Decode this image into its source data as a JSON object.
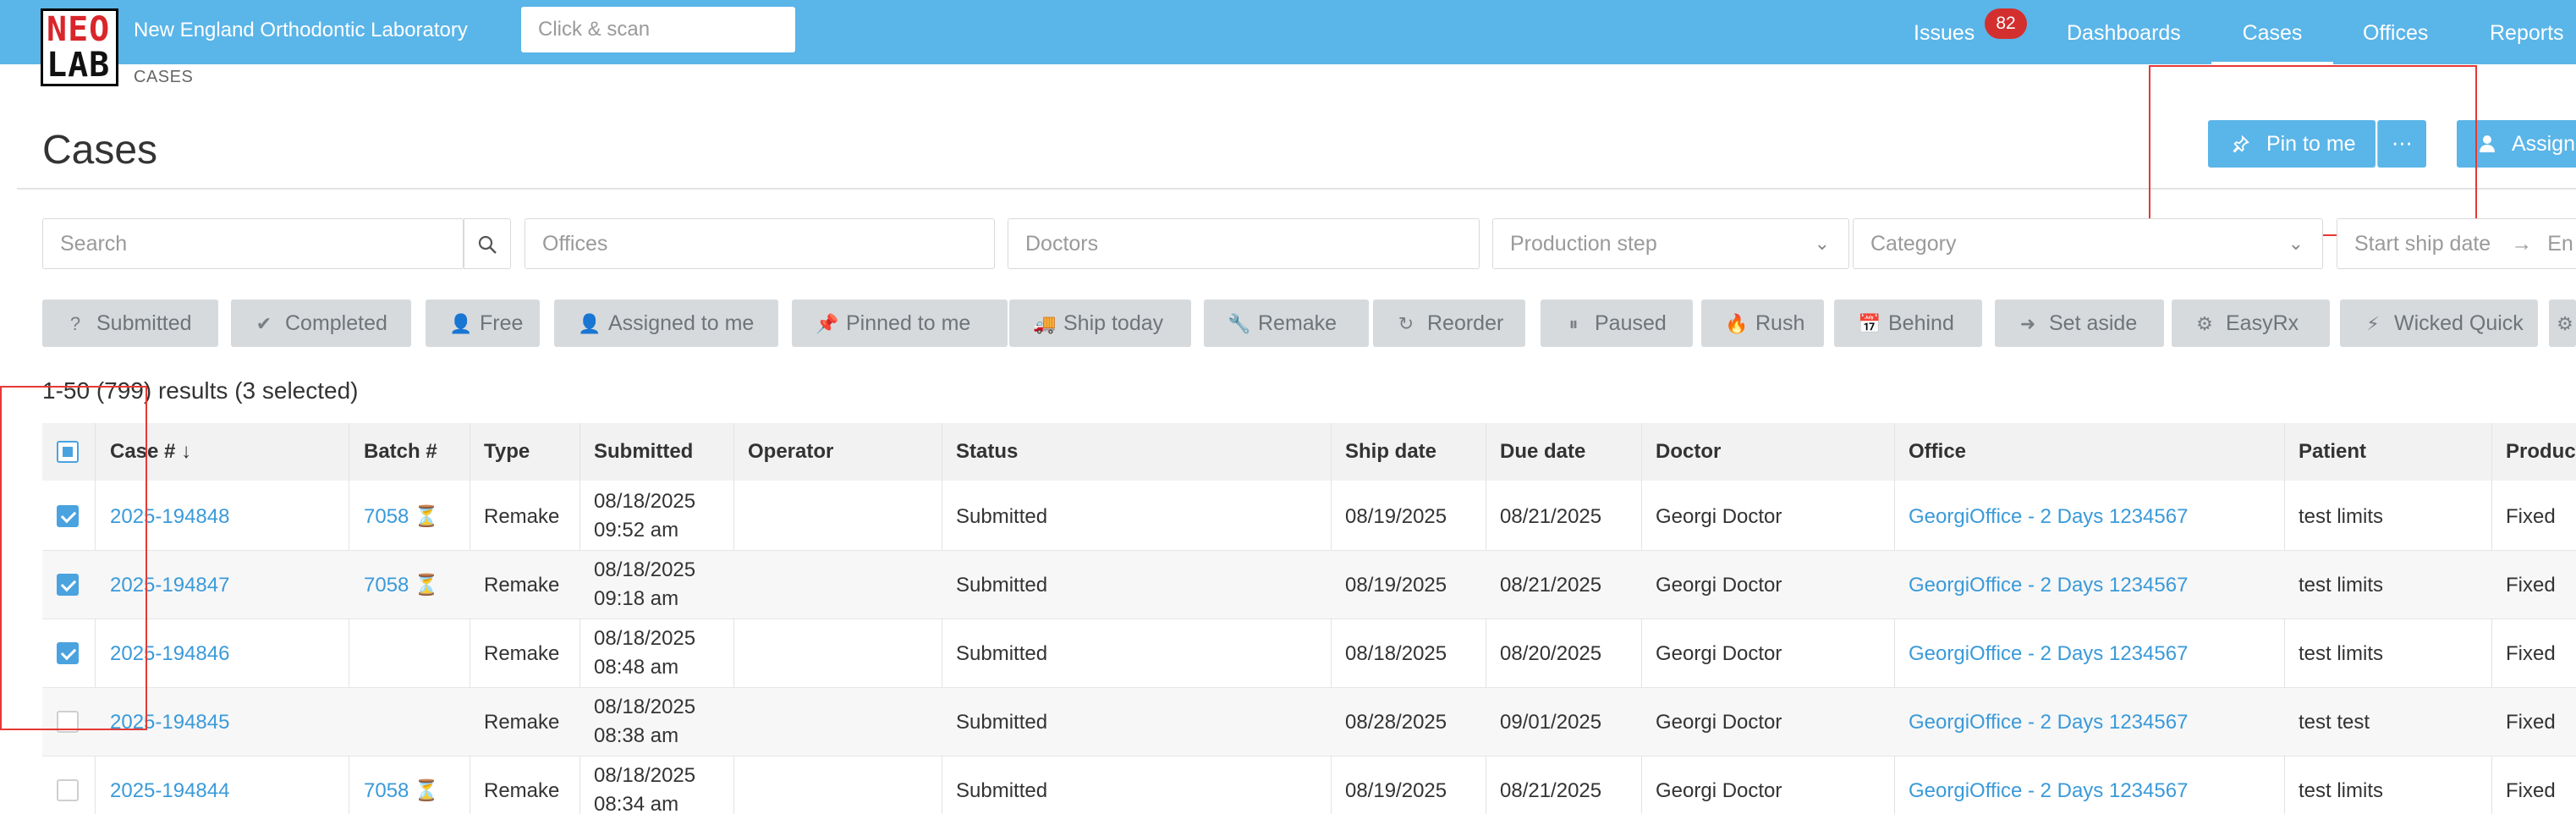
{
  "app": {
    "logo_line1": "NEO",
    "logo_line2": "LAB",
    "brand": "New England Orthodontic Laboratory",
    "scan_placeholder": "Click & scan",
    "nav": {
      "issues": "Issues",
      "issues_count": "82",
      "dashboards": "Dashboards",
      "cases": "Cases",
      "offices": "Offices",
      "reports": "Reports"
    },
    "breadcrumb": "CASES"
  },
  "page": {
    "title": "Cases",
    "pin_label": "Pin to me",
    "more_label": "⋯",
    "assign_label": "Assign"
  },
  "filters": {
    "search": "Search",
    "offices": "Offices",
    "doctors": "Doctors",
    "production_step": "Production step",
    "category": "Category",
    "start_ship_date": "Start ship date",
    "end_ship_date": "En"
  },
  "chips": [
    {
      "label": "Submitted",
      "icon": "question-circle-icon",
      "glyph": "?"
    },
    {
      "label": "Completed",
      "icon": "check-circle-icon",
      "glyph": "✔"
    },
    {
      "label": "Free",
      "icon": "user-outline-icon",
      "glyph": "👤"
    },
    {
      "label": "Assigned to me",
      "icon": "user-icon",
      "glyph": "👤"
    },
    {
      "label": "Pinned to me",
      "icon": "pin-icon",
      "glyph": "📌"
    },
    {
      "label": "Ship today",
      "icon": "truck-icon",
      "glyph": "🚚"
    },
    {
      "label": "Remake",
      "icon": "wrench-icon",
      "glyph": "🔧"
    },
    {
      "label": "Reorder",
      "icon": "redo-icon",
      "glyph": "↻"
    },
    {
      "label": "Paused",
      "icon": "pause-circle-icon",
      "glyph": "⏸"
    },
    {
      "label": "Rush",
      "icon": "fire-icon",
      "glyph": "🔥"
    },
    {
      "label": "Behind",
      "icon": "calendar-clock-icon",
      "glyph": "📅"
    },
    {
      "label": "Set aside",
      "icon": "arrow-circle-right-icon",
      "glyph": "➜"
    },
    {
      "label": "EasyRx",
      "icon": "gears-icon",
      "glyph": "⚙"
    },
    {
      "label": "Wicked Quick",
      "icon": "bolt-icon",
      "glyph": "⚡"
    },
    {
      "label": "",
      "icon": "overflow-chip-icon",
      "glyph": "⚙"
    }
  ],
  "results_text": "1-50 (799) results (3 selected)",
  "table": {
    "columns": {
      "case": "Case #",
      "batch": "Batch #",
      "type": "Type",
      "submitted": "Submitted",
      "operator": "Operator",
      "status": "Status",
      "ship_date": "Ship date",
      "due_date": "Due date",
      "doctor": "Doctor",
      "office": "Office",
      "patient": "Patient",
      "product": "Product"
    },
    "sort_indicator": "↓",
    "rows": [
      {
        "checked": true,
        "case": "2025-194848",
        "batch": "7058",
        "batch_icon": "hourglass-icon",
        "type": "Remake",
        "submitted_date": "08/18/2025",
        "submitted_time": "09:52 am",
        "operator": "",
        "status": "Submitted",
        "ship_date": "08/19/2025",
        "due_date": "08/21/2025",
        "doctor": "Georgi Doctor",
        "office": "GeorgiOffice - 2 Days 1234567",
        "patient": "test limits",
        "product": "Fixed"
      },
      {
        "checked": true,
        "case": "2025-194847",
        "batch": "7058",
        "batch_icon": "hourglass-icon",
        "type": "Remake",
        "submitted_date": "08/18/2025",
        "submitted_time": "09:18 am",
        "operator": "",
        "status": "Submitted",
        "ship_date": "08/19/2025",
        "due_date": "08/21/2025",
        "doctor": "Georgi Doctor",
        "office": "GeorgiOffice - 2 Days 1234567",
        "patient": "test limits",
        "product": "Fixed"
      },
      {
        "checked": true,
        "case": "2025-194846",
        "batch": "",
        "batch_icon": "",
        "type": "Remake",
        "submitted_date": "08/18/2025",
        "submitted_time": "08:48 am",
        "operator": "",
        "status": "Submitted",
        "ship_date": "08/18/2025",
        "due_date": "08/20/2025",
        "doctor": "Georgi Doctor",
        "office": "GeorgiOffice - 2 Days 1234567",
        "patient": "test limits",
        "product": "Fixed"
      },
      {
        "checked": false,
        "case": "2025-194845",
        "batch": "",
        "batch_icon": "",
        "type": "Remake",
        "submitted_date": "08/18/2025",
        "submitted_time": "08:38 am",
        "operator": "",
        "status": "Submitted",
        "ship_date": "08/28/2025",
        "due_date": "09/01/2025",
        "doctor": "Georgi Doctor",
        "office": "GeorgiOffice - 2 Days 1234567",
        "patient": "test test",
        "product": "Fixed"
      },
      {
        "checked": false,
        "case": "2025-194844",
        "batch": "7058",
        "batch_icon": "hourglass-icon",
        "type": "Remake",
        "submitted_date": "08/18/2025",
        "submitted_time": "08:34 am",
        "operator": "",
        "status": "Submitted",
        "ship_date": "08/19/2025",
        "due_date": "08/21/2025",
        "doctor": "Georgi Doctor",
        "office": "GeorgiOffice - 2 Days 1234567",
        "patient": "test limits",
        "product": "Fixed"
      }
    ]
  },
  "colors": {
    "topbar": "#5ab5e8",
    "link": "#3a9ad9",
    "badge": "#d32f2f",
    "chip_bg": "#d6dadd",
    "hourglass": "#f0a030",
    "highlight_box": "#e53935"
  }
}
